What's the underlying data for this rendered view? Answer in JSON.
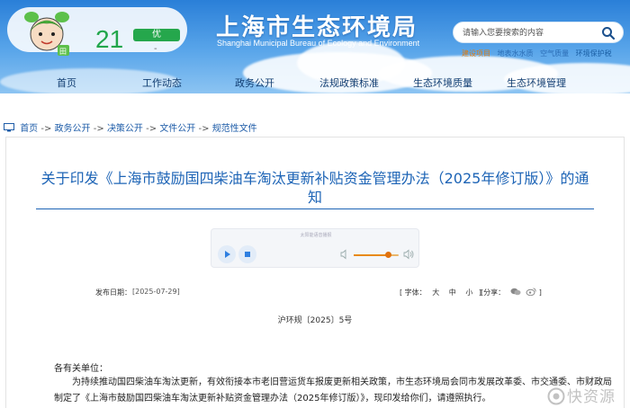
{
  "header": {
    "site_title": "上海市生态环境局",
    "site_subtitle": "Shanghai Municipal Bureau of Ecology and Environment",
    "mascot_badge": "田"
  },
  "weather": {
    "aqi_value": "21",
    "aqi_level": "优",
    "aqi_extra": "-",
    "level_color": "#25a74c"
  },
  "search": {
    "placeholder": "请输入您要搜索的内容"
  },
  "quick_links": [
    "建设项目",
    "地表水水质",
    "空气质量",
    "环境保护税"
  ],
  "nav": {
    "items": [
      "首页",
      "工作动态",
      "政务公开",
      "法规政策标准",
      "生态环境质量",
      "生态环境管理"
    ]
  },
  "breadcrumb": {
    "items": [
      "首页",
      "政务公开",
      "决策公开",
      "文件公开",
      "规范性文件"
    ],
    "separator": "->"
  },
  "document": {
    "title": "关于印发《上海市鼓励国四柴油车淘汰更新补贴资金管理办法（2025年修订版）》的通知",
    "player_caption": "太阳能语音播报",
    "volume_fraction": 0.75,
    "publish_label": "发布日期：",
    "publish_date": "[2025-07-29]",
    "font_label_open": "[ 字体：",
    "font_sizes": [
      "大",
      "中",
      "小"
    ],
    "font_label_close": "]",
    "share_label": "[分享：",
    "share_close": "]",
    "doc_number": "沪环规〔2025〕5号",
    "salutation": "各有关单位：",
    "body": "为持续推动国四柴油车淘汰更新，有效衔接本市老旧营运货车报废更新相关政策，市生态环境局会同市发展改革委、市交通委、市财政局制定了《上海市鼓励国四柴油车淘汰更新补贴资金管理办法（2025年修订版）》，现印发给你们，请遵照执行。"
  },
  "watermark": {
    "text": "快资源"
  },
  "colors": {
    "header_blue": "#2a7fd8",
    "title_blue": "#1d64b6",
    "link_blue": "#1e5ca8",
    "accent_orange": "#e0720e"
  }
}
